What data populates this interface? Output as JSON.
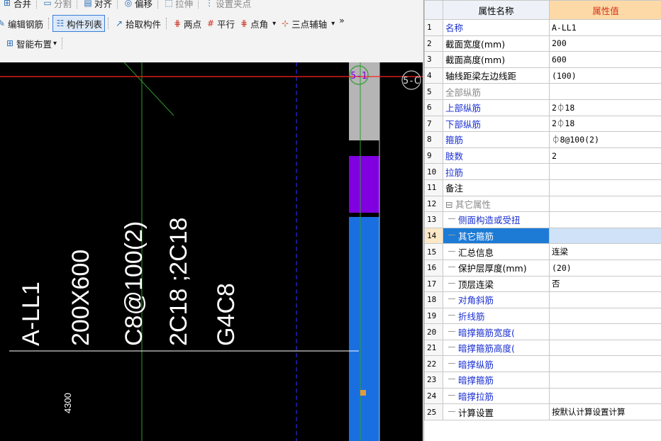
{
  "toolbar": {
    "row0": [
      "合并",
      "分割",
      "对齐",
      "偏移",
      "拉伸",
      "设置夹点"
    ],
    "row1": [
      {
        "label": "编辑钢筋",
        "icon": "edit-rebar-icon"
      },
      {
        "label": "构件列表",
        "icon": "list-icon",
        "active": true
      },
      {
        "label": "拾取构件",
        "icon": "pick-icon"
      },
      {
        "label": "两点",
        "icon": "two-point-icon"
      },
      {
        "label": "平行",
        "icon": "parallel-icon"
      },
      {
        "label": "点角",
        "icon": "point-angle-icon",
        "dropdown": true
      },
      {
        "label": "三点辅轴",
        "icon": "three-point-axis-icon",
        "dropdown": true
      }
    ],
    "overflow": "»",
    "row2": {
      "label": "智能布置",
      "icon": "smart-layout-icon"
    }
  },
  "canvas": {
    "axis_labels": [
      "5-1",
      "5-C"
    ],
    "annotation_lines": [
      "A-LL1",
      "200X600",
      "C8@100(2)",
      "2C18 ;2C18",
      "G4C8"
    ],
    "dimension": "4300",
    "colors": {
      "background": "#000000",
      "text": "#ffffff",
      "red_line": "#ff2020",
      "green_line": "#2e9b2e",
      "blue_dash": "#2a2ae0",
      "beam_gray": "#b5b5b5",
      "beam_purple": "#8000e0",
      "beam_blue": "#1a6fe0",
      "grip": "#e39a3c"
    }
  },
  "properties": {
    "header": {
      "name": "属性名称",
      "value": "属性值"
    },
    "rows": [
      {
        "n": "1",
        "name": "名称",
        "value": "A-LL1",
        "style": "blue"
      },
      {
        "n": "2",
        "name": "截面宽度(mm)",
        "value": "200",
        "style": "black"
      },
      {
        "n": "3",
        "name": "截面高度(mm)",
        "value": "600",
        "style": "black"
      },
      {
        "n": "4",
        "name": "轴线距梁左边线距",
        "value": "(100)",
        "style": "black"
      },
      {
        "n": "5",
        "name": "全部纵筋",
        "value": "",
        "style": "gray"
      },
      {
        "n": "6",
        "name": "上部纵筋",
        "value": "2⏀18",
        "style": "blue"
      },
      {
        "n": "7",
        "name": "下部纵筋",
        "value": "2⏀18",
        "style": "blue"
      },
      {
        "n": "8",
        "name": "箍筋",
        "value": "⏀8@100(2)",
        "style": "blue"
      },
      {
        "n": "9",
        "name": "肢数",
        "value": "2",
        "style": "blue"
      },
      {
        "n": "10",
        "name": "拉筋",
        "value": "",
        "style": "blue"
      },
      {
        "n": "11",
        "name": "备注",
        "value": "",
        "style": "black"
      },
      {
        "n": "12",
        "name": "其它属性",
        "value": "",
        "style": "gray",
        "tree": "⊟"
      },
      {
        "n": "13",
        "name": "侧面构造或受扭",
        "value": "",
        "style": "blue",
        "tree": "—"
      },
      {
        "n": "14",
        "name": "其它箍筋",
        "value": "",
        "style": "blue",
        "tree": "—",
        "selected": true
      },
      {
        "n": "15",
        "name": "汇总信息",
        "value": "连梁",
        "style": "black",
        "tree": "—"
      },
      {
        "n": "16",
        "name": "保护层厚度(mm)",
        "value": "(20)",
        "style": "black",
        "tree": "—"
      },
      {
        "n": "17",
        "name": "顶层连梁",
        "value": "否",
        "style": "black",
        "tree": "—"
      },
      {
        "n": "18",
        "name": "对角斜筋",
        "value": "",
        "style": "blue",
        "tree": "—"
      },
      {
        "n": "19",
        "name": "折线筋",
        "value": "",
        "style": "blue",
        "tree": "—"
      },
      {
        "n": "20",
        "name": "暗撑箍筋宽度(",
        "value": "",
        "style": "blue",
        "tree": "—"
      },
      {
        "n": "21",
        "name": "暗撑箍筋高度(",
        "value": "",
        "style": "blue",
        "tree": "—"
      },
      {
        "n": "22",
        "name": "暗撑纵筋",
        "value": "",
        "style": "blue",
        "tree": "—"
      },
      {
        "n": "23",
        "name": "暗撑箍筋",
        "value": "",
        "style": "blue",
        "tree": "—"
      },
      {
        "n": "24",
        "name": "暗撑拉筋",
        "value": "",
        "style": "blue",
        "tree": "—"
      },
      {
        "n": "25",
        "name": "计算设置",
        "value": "按默认计算设置计算",
        "style": "black",
        "tree": "—"
      }
    ]
  }
}
